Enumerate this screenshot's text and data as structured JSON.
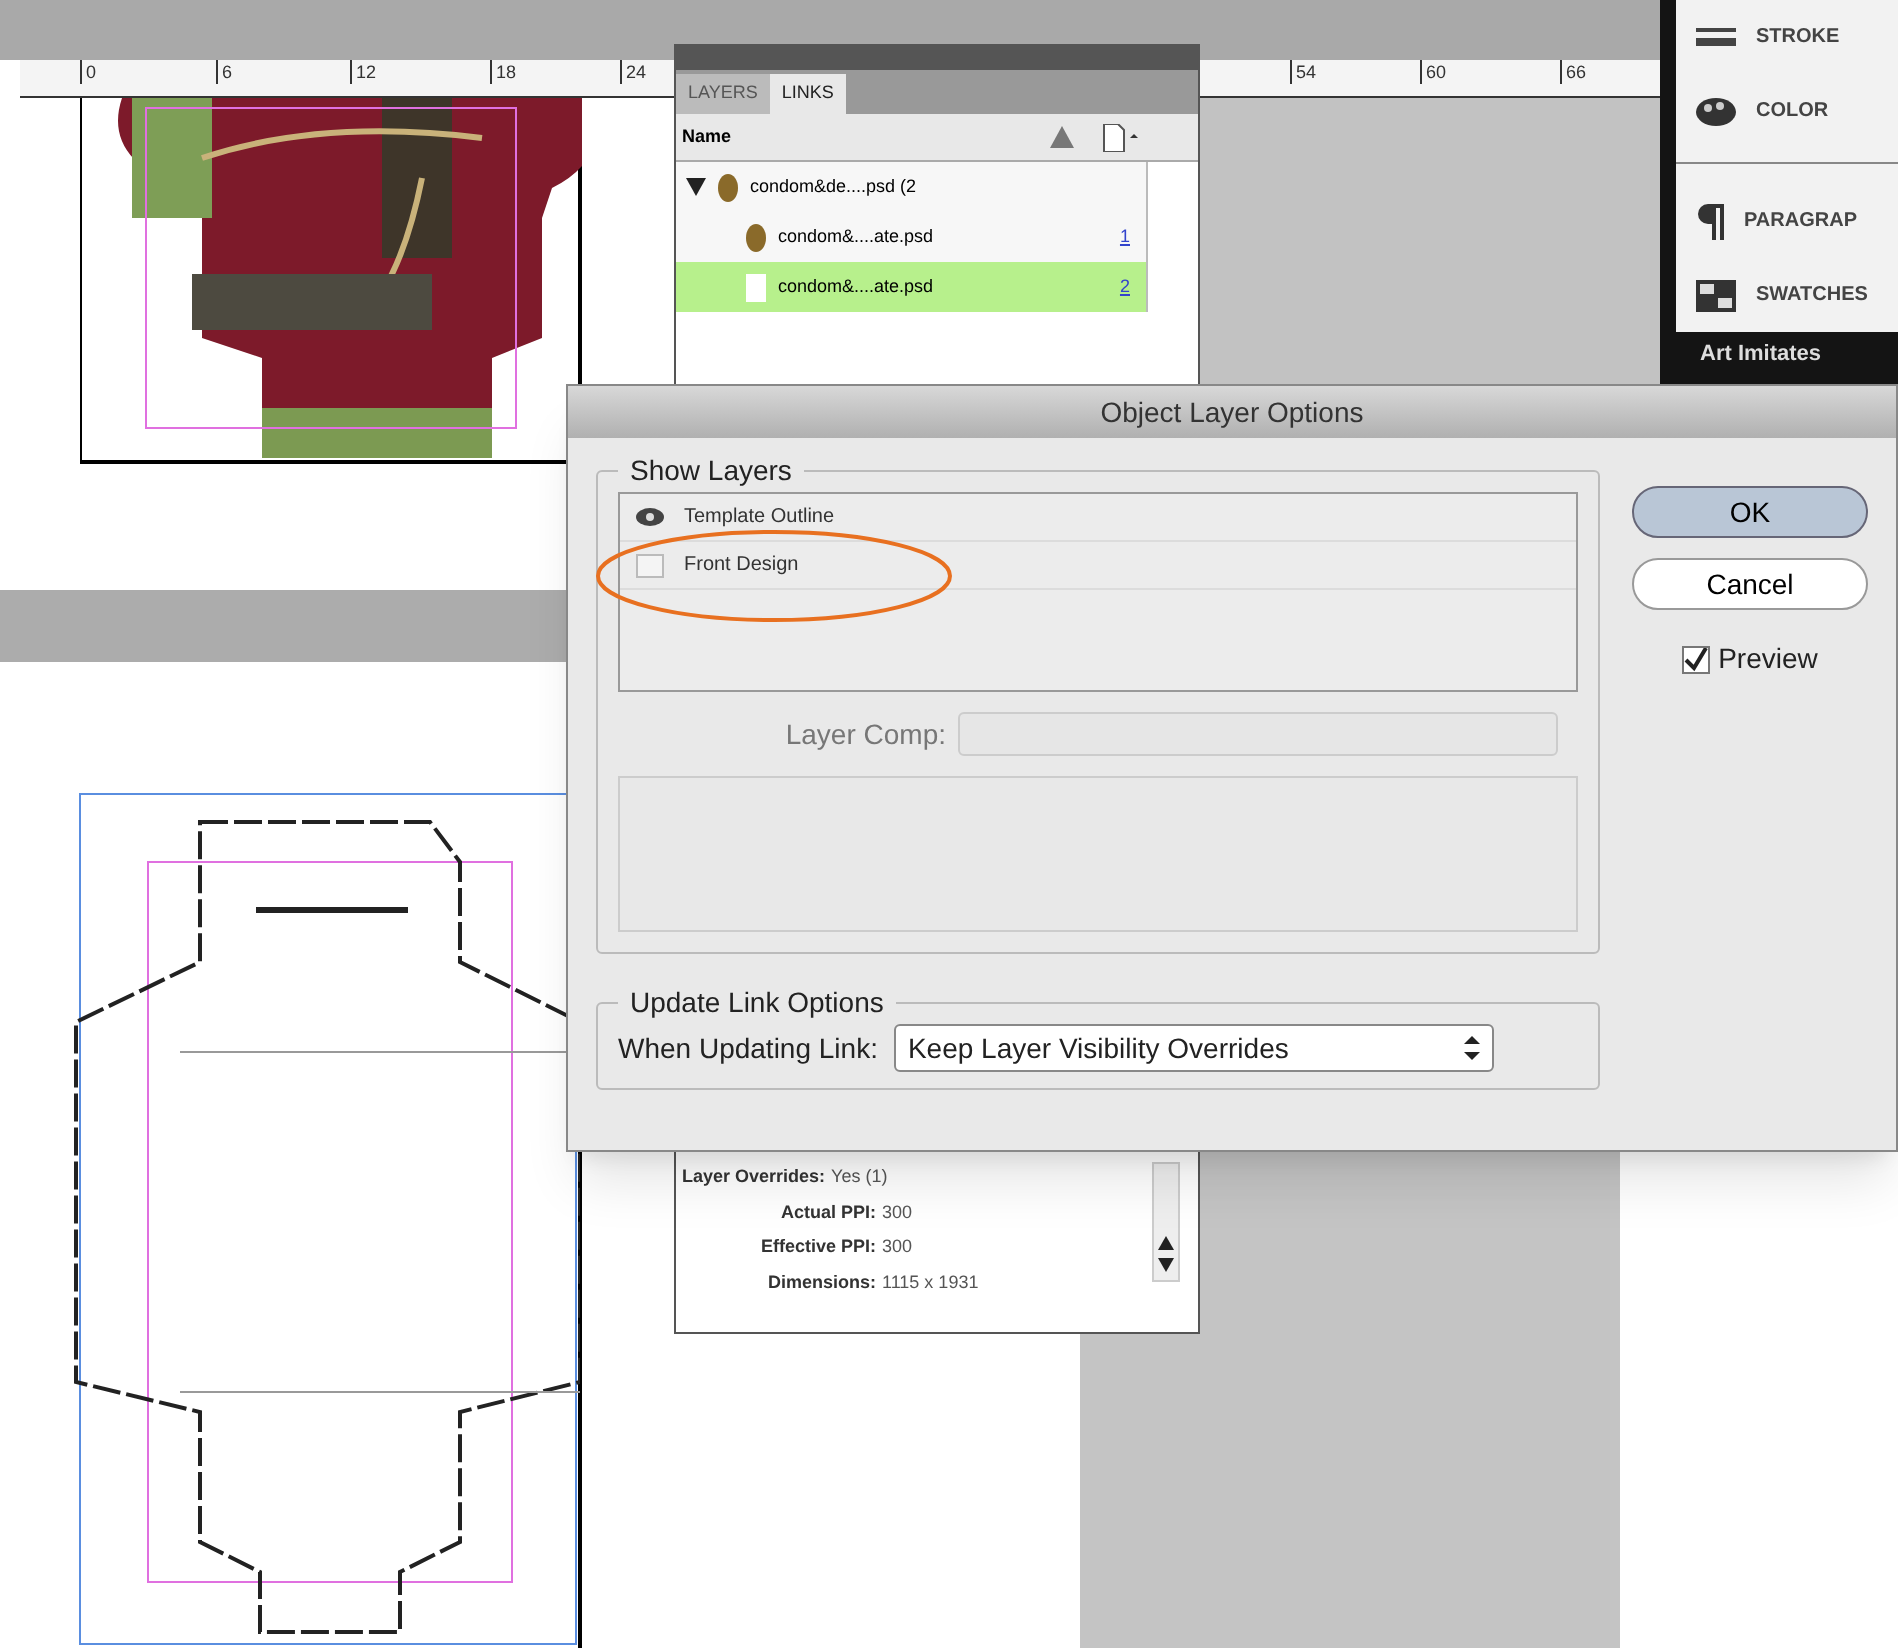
{
  "ruler": {
    "ticks": [
      "0",
      "6",
      "12",
      "18",
      "24",
      "54",
      "60",
      "66"
    ]
  },
  "links_panel": {
    "tabs": [
      {
        "label": "LAYERS",
        "selected": false
      },
      {
        "label": "LINKS",
        "selected": true
      }
    ],
    "column": "Name",
    "items": [
      {
        "name": "condom&de....psd (2",
        "expanded": true,
        "children": [
          {
            "name": "condom&....ate.psd",
            "page": "1",
            "selected": false
          },
          {
            "name": "condom&....ate.psd",
            "page": "2",
            "selected": true
          }
        ]
      }
    ],
    "info": [
      {
        "label": "Layer Overrides:",
        "value": "Yes (1)"
      },
      {
        "label": "Actual PPI:",
        "value": "300"
      },
      {
        "label": "Effective PPI:",
        "value": "300"
      },
      {
        "label": "Dimensions:",
        "value": "1115 x 1931"
      }
    ]
  },
  "side_panels": [
    {
      "kind": "stroke",
      "label": "STROKE"
    },
    {
      "kind": "color",
      "label": "COLOR"
    },
    {
      "kind": "paragraph",
      "label": "PARAGRAP"
    },
    {
      "kind": "swatches",
      "label": "SWATCHES"
    }
  ],
  "background_text": "Art Imitates",
  "dialog": {
    "title": "Object Layer Options",
    "show_layers": {
      "legend": "Show Layers",
      "layers": [
        {
          "name": "Template Outline",
          "visible": true
        },
        {
          "name": "Front Design",
          "visible": false
        }
      ]
    },
    "layer_comp": {
      "label": "Layer Comp:",
      "disabled": true
    },
    "update_link": {
      "legend": "Update Link Options",
      "label": "When Updating Link:",
      "value": "Keep Layer Visibility Overrides"
    },
    "buttons": [
      {
        "label": "OK",
        "default": true
      },
      {
        "label": "Cancel",
        "default": false
      }
    ],
    "preview": {
      "label": "Preview",
      "checked": true
    }
  }
}
